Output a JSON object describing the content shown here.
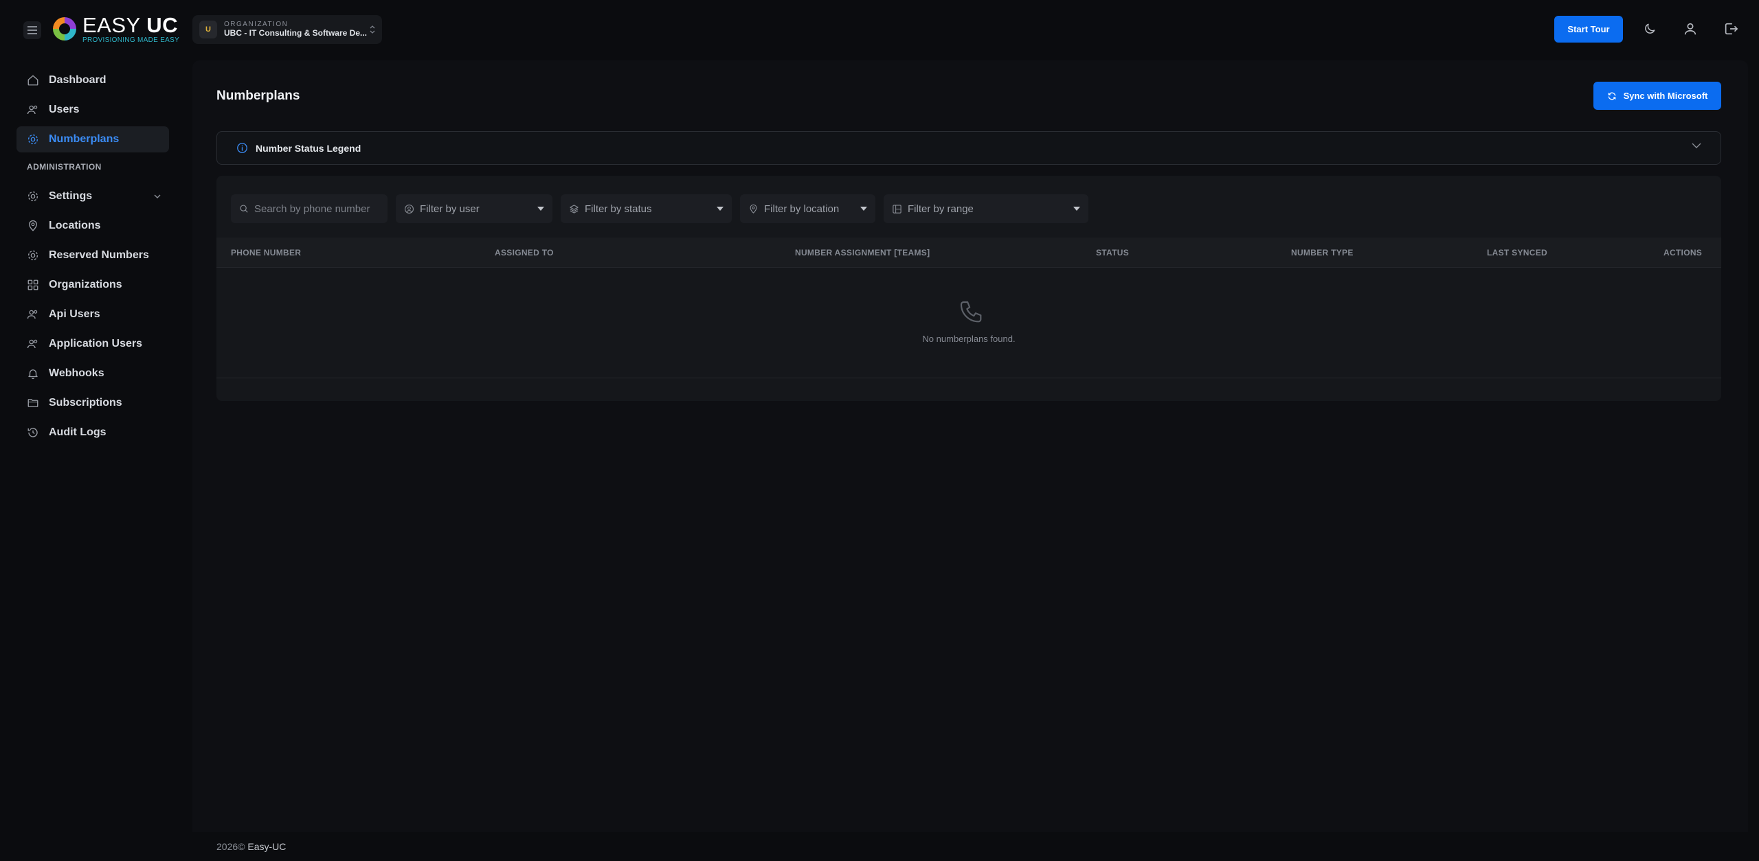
{
  "header": {
    "logo_main": "EASY",
    "logo_bold": "UC",
    "logo_sub": "PROVISIONING MADE EASY",
    "org_label": "ORGANIZATION",
    "org_avatar": "U",
    "org_name": "UBC - IT Consulting & Software De...",
    "start_tour": "Start Tour"
  },
  "sidebar": {
    "items": [
      {
        "label": "Dashboard",
        "icon": "home-icon"
      },
      {
        "label": "Users",
        "icon": "users-icon"
      },
      {
        "label": "Numberplans",
        "icon": "gear-icon",
        "active": true
      }
    ],
    "section_label": "ADMINISTRATION",
    "admin_items": [
      {
        "label": "Settings",
        "icon": "gear-icon"
      },
      {
        "label": "Locations",
        "icon": "map-pin-icon"
      },
      {
        "label": "Reserved Numbers",
        "icon": "gear-icon"
      },
      {
        "label": "Organizations",
        "icon": "grid-icon"
      },
      {
        "label": "Api Users",
        "icon": "users-icon"
      },
      {
        "label": "Application Users",
        "icon": "users-icon"
      },
      {
        "label": "Webhooks",
        "icon": "bell-icon"
      },
      {
        "label": "Subscriptions",
        "icon": "folder-icon"
      },
      {
        "label": "Audit Logs",
        "icon": "history-icon"
      }
    ]
  },
  "main": {
    "title": "Numberplans",
    "sync_button": "Sync with Microsoft",
    "legend_title": "Number Status Legend",
    "filters": {
      "search_placeholder": "Search by phone number",
      "user": "Filter by user",
      "status": "Filter by status",
      "location": "Filter by location",
      "range": "Filter by range"
    },
    "columns": [
      "PHONE NUMBER",
      "ASSIGNED TO",
      "NUMBER ASSIGNMENT [TEAMS]",
      "STATUS",
      "NUMBER TYPE",
      "LAST SYNCED",
      "ACTIONS"
    ],
    "empty_text": "No numberplans found."
  },
  "footer": {
    "year": "2026©",
    "brand": "Easy-UC"
  },
  "colors": {
    "accent": "#0b6cf0",
    "active_nav": "#3b8cf5",
    "background": "#0b0c0f"
  }
}
